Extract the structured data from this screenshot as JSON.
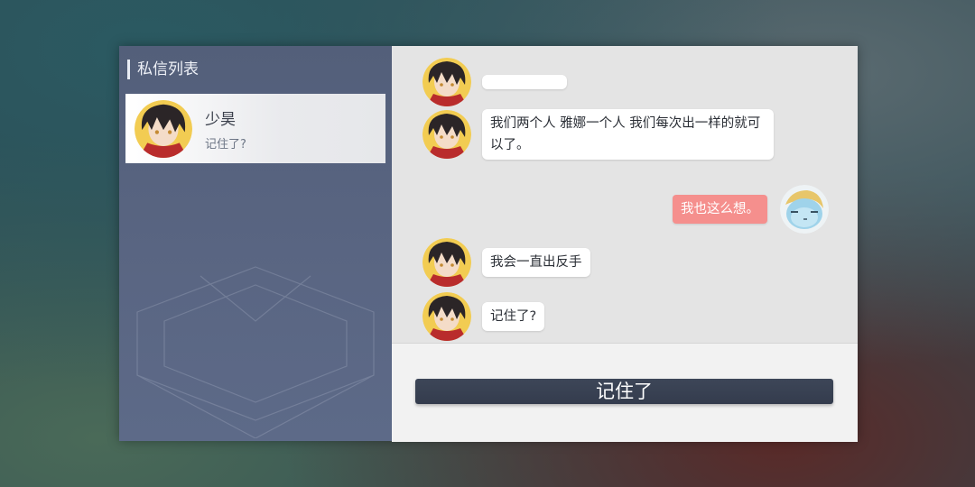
{
  "sidebar": {
    "title": "私信列表",
    "contacts": [
      {
        "name": "少昊",
        "preview": "记住了?",
        "avatar_icon": "shaohao-avatar-icon"
      }
    ]
  },
  "chat": {
    "messages": [
      {
        "sender": "少昊",
        "text": "",
        "side": "left"
      },
      {
        "sender": "少昊",
        "text": "我们两个人 雅娜一个人 我们每次出一样的就可以了。",
        "side": "left"
      },
      {
        "sender": "me",
        "text": "我也这么想。",
        "side": "right"
      },
      {
        "sender": "少昊",
        "text": "我会一直出反手",
        "side": "left"
      },
      {
        "sender": "少昊",
        "text": "记住了?",
        "side": "left"
      }
    ]
  },
  "reply": {
    "option_label": "记住了"
  },
  "colors": {
    "panel_left": "#586580",
    "chat_bg": "#e4e4e4",
    "my_bubble": "#f58f8d",
    "reply_button": "#3a4255"
  }
}
